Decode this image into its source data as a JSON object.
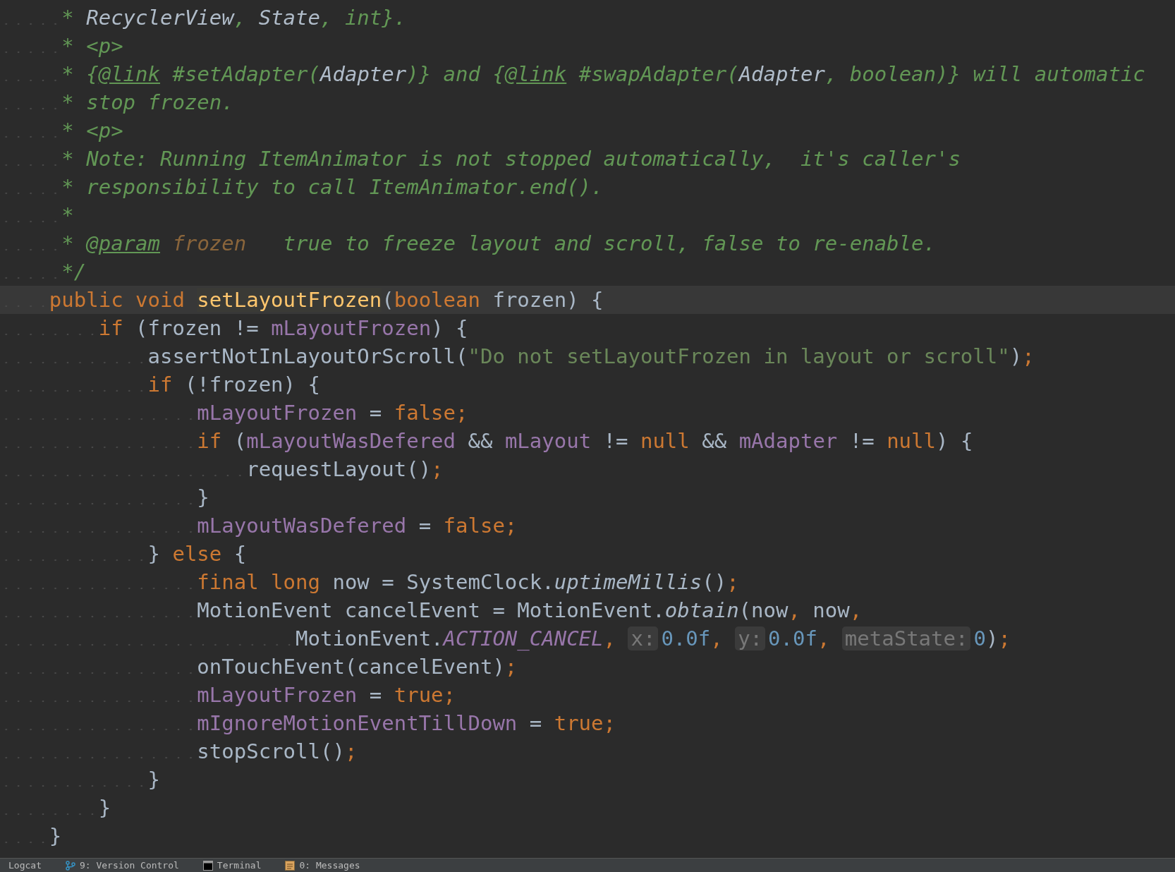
{
  "editor": {
    "lines": [
      {
        "current": false,
        "tokens": [
          {
            "text": "     * ",
            "kind": "comment"
          },
          {
            "text": "RecyclerView",
            "kind": "docref"
          },
          {
            "text": ", ",
            "kind": "comment"
          },
          {
            "text": "State",
            "kind": "docref"
          },
          {
            "text": ", int}.",
            "kind": "comment"
          }
        ]
      },
      {
        "current": false,
        "tokens": [
          {
            "text": "     * <p>",
            "kind": "comment"
          }
        ]
      },
      {
        "current": false,
        "tokens": [
          {
            "text": "     * {",
            "kind": "comment"
          },
          {
            "text": "@link",
            "kind": "doctag"
          },
          {
            "text": " #setAdapter(",
            "kind": "comment"
          },
          {
            "text": "Adapter",
            "kind": "docref"
          },
          {
            "text": ")} and {",
            "kind": "comment"
          },
          {
            "text": "@link",
            "kind": "doctag"
          },
          {
            "text": " #swapAdapter(",
            "kind": "comment"
          },
          {
            "text": "Adapter",
            "kind": "docref"
          },
          {
            "text": ", boolean)} will automatic",
            "kind": "comment"
          }
        ]
      },
      {
        "current": false,
        "tokens": [
          {
            "text": "     * stop frozen.",
            "kind": "comment"
          }
        ]
      },
      {
        "current": false,
        "tokens": [
          {
            "text": "     * <p>",
            "kind": "comment"
          }
        ]
      },
      {
        "current": false,
        "tokens": [
          {
            "text": "     * Note: Running ItemAnimator is not stopped automatically,  it's caller's",
            "kind": "comment"
          }
        ]
      },
      {
        "current": false,
        "tokens": [
          {
            "text": "     * responsibility to call ItemAnimator.end().",
            "kind": "comment"
          }
        ]
      },
      {
        "current": false,
        "tokens": [
          {
            "text": "     *",
            "kind": "comment"
          }
        ]
      },
      {
        "current": false,
        "tokens": [
          {
            "text": "     * ",
            "kind": "comment"
          },
          {
            "text": "@param",
            "kind": "doctag"
          },
          {
            "text": " frozen",
            "kind": "param"
          },
          {
            "text": "   true to freeze layout and scroll, false to re-enable.",
            "kind": "comment"
          }
        ]
      },
      {
        "current": false,
        "tokens": [
          {
            "text": "     */",
            "kind": "comment"
          }
        ]
      },
      {
        "current": true,
        "tokens": [
          {
            "text": "    public void ",
            "kind": "keyword"
          },
          {
            "text": "setLayoutFrozen",
            "kind": "decl"
          },
          {
            "text": "(",
            "kind": "plain"
          },
          {
            "text": "boolean ",
            "kind": "keyword"
          },
          {
            "text": "frozen) {",
            "kind": "plain"
          }
        ]
      },
      {
        "current": false,
        "tokens": [
          {
            "text": "        if ",
            "kind": "keyword"
          },
          {
            "text": "(frozen != ",
            "kind": "plain"
          },
          {
            "text": "mLayoutFrozen",
            "kind": "field"
          },
          {
            "text": ") {",
            "kind": "plain"
          }
        ]
      },
      {
        "current": false,
        "tokens": [
          {
            "text": "            assertNotInLayoutOrScroll(",
            "kind": "plain"
          },
          {
            "text": "\"Do not setLayoutFrozen in layout or scroll\"",
            "kind": "string"
          },
          {
            "text": ")",
            "kind": "plain"
          },
          {
            "text": ";",
            "kind": "keyword"
          }
        ]
      },
      {
        "current": false,
        "tokens": [
          {
            "text": "            if ",
            "kind": "keyword"
          },
          {
            "text": "(!frozen) {",
            "kind": "plain"
          }
        ]
      },
      {
        "current": false,
        "tokens": [
          {
            "text": "                mLayoutFrozen",
            "kind": "field"
          },
          {
            "text": " = ",
            "kind": "plain"
          },
          {
            "text": "false;",
            "kind": "keyword"
          }
        ]
      },
      {
        "current": false,
        "tokens": [
          {
            "text": "                if ",
            "kind": "keyword"
          },
          {
            "text": "(",
            "kind": "plain"
          },
          {
            "text": "mLayoutWasDefered",
            "kind": "field"
          },
          {
            "text": " && ",
            "kind": "plain"
          },
          {
            "text": "mLayout",
            "kind": "field"
          },
          {
            "text": " != ",
            "kind": "plain"
          },
          {
            "text": "null",
            "kind": "keyword"
          },
          {
            "text": " && ",
            "kind": "plain"
          },
          {
            "text": "mAdapter",
            "kind": "field"
          },
          {
            "text": " != ",
            "kind": "plain"
          },
          {
            "text": "null",
            "kind": "keyword"
          },
          {
            "text": ") {",
            "kind": "plain"
          }
        ]
      },
      {
        "current": false,
        "tokens": [
          {
            "text": "                    requestLayout()",
            "kind": "plain"
          },
          {
            "text": ";",
            "kind": "keyword"
          }
        ]
      },
      {
        "current": false,
        "tokens": [
          {
            "text": "                }",
            "kind": "plain"
          }
        ]
      },
      {
        "current": false,
        "tokens": [
          {
            "text": "                mLayoutWasDefered",
            "kind": "field"
          },
          {
            "text": " = ",
            "kind": "plain"
          },
          {
            "text": "false;",
            "kind": "keyword"
          }
        ]
      },
      {
        "current": false,
        "tokens": [
          {
            "text": "            } ",
            "kind": "plain"
          },
          {
            "text": "else ",
            "kind": "keyword"
          },
          {
            "text": "{",
            "kind": "plain"
          }
        ]
      },
      {
        "current": false,
        "tokens": [
          {
            "text": "                final long ",
            "kind": "keyword"
          },
          {
            "text": "now = SystemClock.",
            "kind": "plain"
          },
          {
            "text": "uptimeMillis",
            "kind": "static"
          },
          {
            "text": "()",
            "kind": "plain"
          },
          {
            "text": ";",
            "kind": "keyword"
          }
        ]
      },
      {
        "current": false,
        "tokens": [
          {
            "text": "                MotionEvent cancelEvent = MotionEvent.",
            "kind": "plain"
          },
          {
            "text": "obtain",
            "kind": "static"
          },
          {
            "text": "(now",
            "kind": "plain"
          },
          {
            "text": ", ",
            "kind": "keyword"
          },
          {
            "text": "now",
            "kind": "plain"
          },
          {
            "text": ",",
            "kind": "keyword"
          }
        ]
      },
      {
        "current": false,
        "tokens": [
          {
            "text": "                        MotionEvent.",
            "kind": "plain"
          },
          {
            "text": "ACTION_CANCEL",
            "kind": "constant"
          },
          {
            "text": ", ",
            "kind": "keyword"
          },
          {
            "text": "x:",
            "kind": "hint"
          },
          {
            "text": "0.0f",
            "kind": "number"
          },
          {
            "text": ", ",
            "kind": "keyword"
          },
          {
            "text": "y:",
            "kind": "hint"
          },
          {
            "text": "0.0f",
            "kind": "number"
          },
          {
            "text": ", ",
            "kind": "keyword"
          },
          {
            "text": "metaState:",
            "kind": "hint"
          },
          {
            "text": "0",
            "kind": "number"
          },
          {
            "text": ")",
            "kind": "plain"
          },
          {
            "text": ";",
            "kind": "keyword"
          }
        ]
      },
      {
        "current": false,
        "tokens": [
          {
            "text": "                onTouchEvent(cancelEvent)",
            "kind": "plain"
          },
          {
            "text": ";",
            "kind": "keyword"
          }
        ]
      },
      {
        "current": false,
        "tokens": [
          {
            "text": "                mLayoutFrozen",
            "kind": "field"
          },
          {
            "text": " = ",
            "kind": "plain"
          },
          {
            "text": "true;",
            "kind": "keyword"
          }
        ]
      },
      {
        "current": false,
        "tokens": [
          {
            "text": "                mIgnoreMotionEventTillDown",
            "kind": "field"
          },
          {
            "text": " = ",
            "kind": "plain"
          },
          {
            "text": "true;",
            "kind": "keyword"
          }
        ]
      },
      {
        "current": false,
        "tokens": [
          {
            "text": "                stopScroll()",
            "kind": "plain"
          },
          {
            "text": ";",
            "kind": "keyword"
          }
        ]
      },
      {
        "current": false,
        "tokens": [
          {
            "text": "            }",
            "kind": "plain"
          }
        ]
      },
      {
        "current": false,
        "tokens": [
          {
            "text": "        }",
            "kind": "plain"
          }
        ]
      },
      {
        "current": false,
        "tokens": [
          {
            "text": "    }",
            "kind": "plain"
          }
        ]
      }
    ]
  },
  "tool_tabs": [
    {
      "label": "Logcat"
    },
    {
      "label": "9: Version Control"
    },
    {
      "label": "Terminal"
    },
    {
      "label": "0: Messages"
    }
  ]
}
